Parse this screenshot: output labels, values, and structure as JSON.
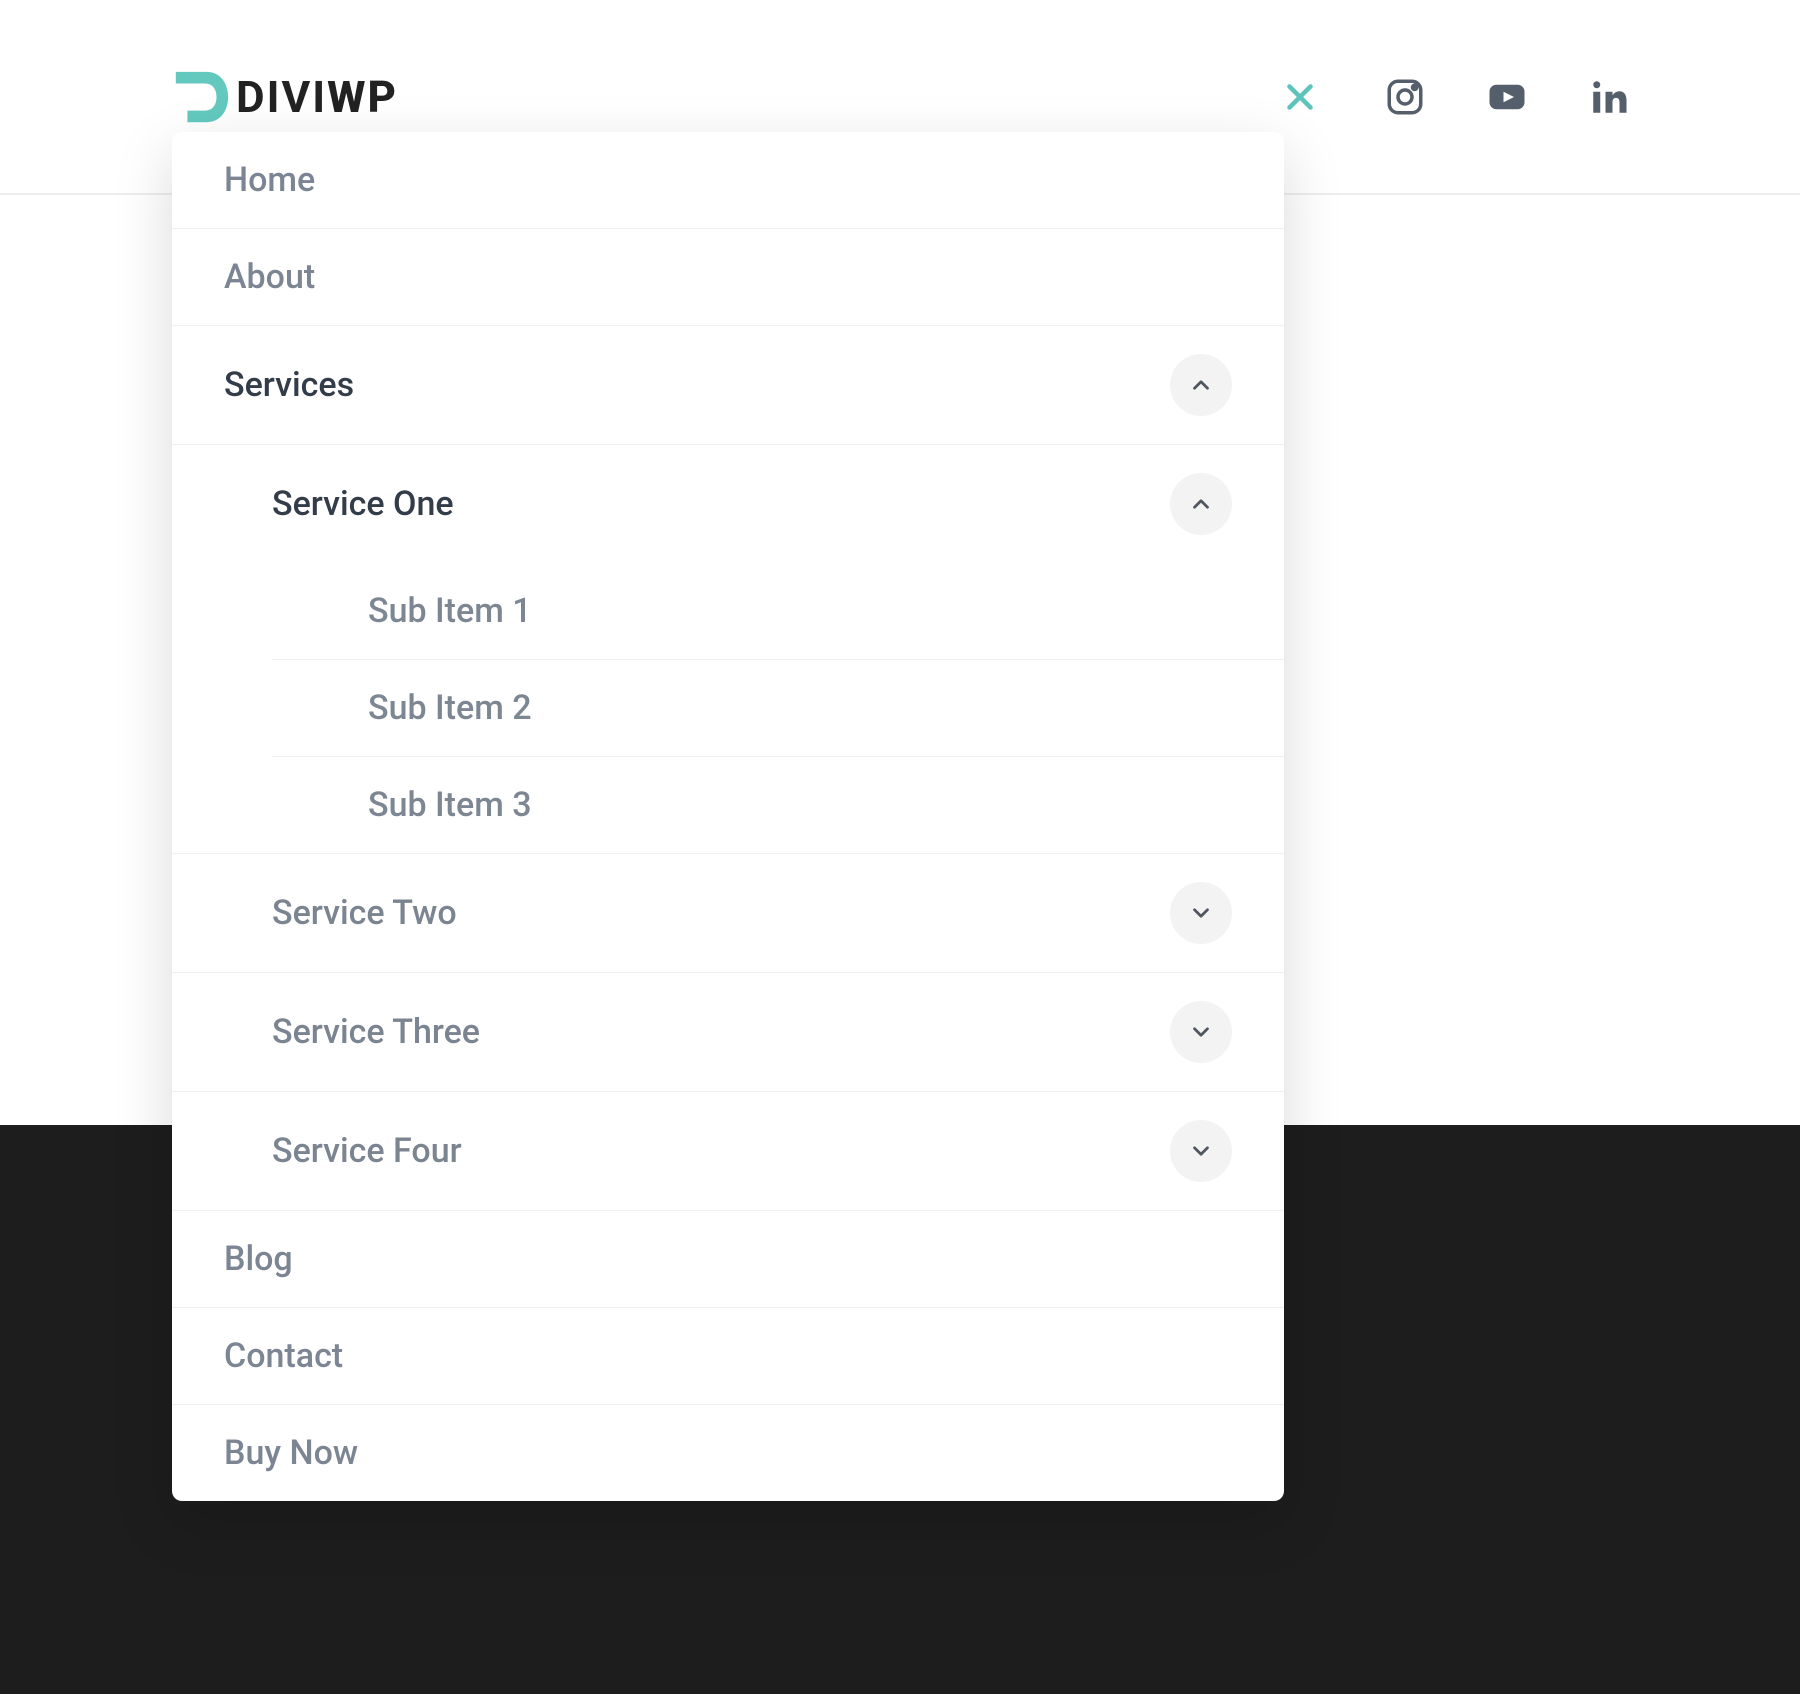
{
  "brand": {
    "name_part1": "DIVI",
    "name_part2": "WP",
    "accent_color": "#5dc4bb"
  },
  "header": {
    "social": {
      "instagram": "instagram",
      "youtube": "youtube",
      "linkedin": "linkedin"
    }
  },
  "menu": {
    "items": [
      {
        "label": "Home"
      },
      {
        "label": "About"
      },
      {
        "label": "Services",
        "expanded": true
      },
      {
        "label": "Blog"
      },
      {
        "label": "Contact"
      },
      {
        "label": "Buy Now"
      }
    ],
    "services": {
      "items": [
        {
          "label": "Service One",
          "expanded": true
        },
        {
          "label": "Service Two",
          "expanded": false
        },
        {
          "label": "Service Three",
          "expanded": false
        },
        {
          "label": "Service Four",
          "expanded": false
        }
      ],
      "service_one_sub": [
        {
          "label": "Sub Item 1"
        },
        {
          "label": "Sub Item 2"
        },
        {
          "label": "Sub Item 3"
        }
      ]
    }
  }
}
